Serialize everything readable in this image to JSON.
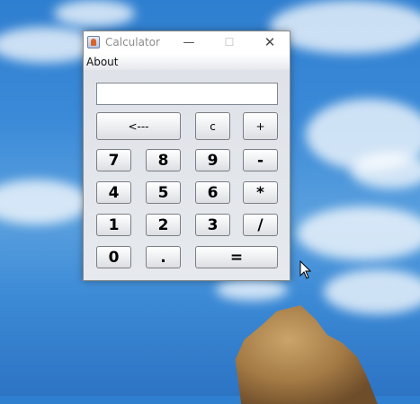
{
  "window": {
    "title": "Calculator",
    "controls": {
      "minimize": "—",
      "maximize": "☐",
      "close": "✕"
    },
    "menu": [
      "About"
    ]
  },
  "display": {
    "value": ""
  },
  "buttons": {
    "backspace": "<---",
    "clear": "c",
    "plus": "+",
    "seven": "7",
    "eight": "8",
    "nine": "9",
    "minus": "-",
    "four": "4",
    "five": "5",
    "six": "6",
    "multiply": "*",
    "one": "1",
    "two": "2",
    "three": "3",
    "divide": "/",
    "zero": "0",
    "dot": ".",
    "equals": "="
  },
  "colors": {
    "sky": "#3b8ad8",
    "button_border": "#7b7e84",
    "panel": "#e2e5ea"
  },
  "icons": [
    "java-app-icon",
    "minimize-icon",
    "maximize-icon",
    "close-icon",
    "mouse-cursor-icon"
  ]
}
